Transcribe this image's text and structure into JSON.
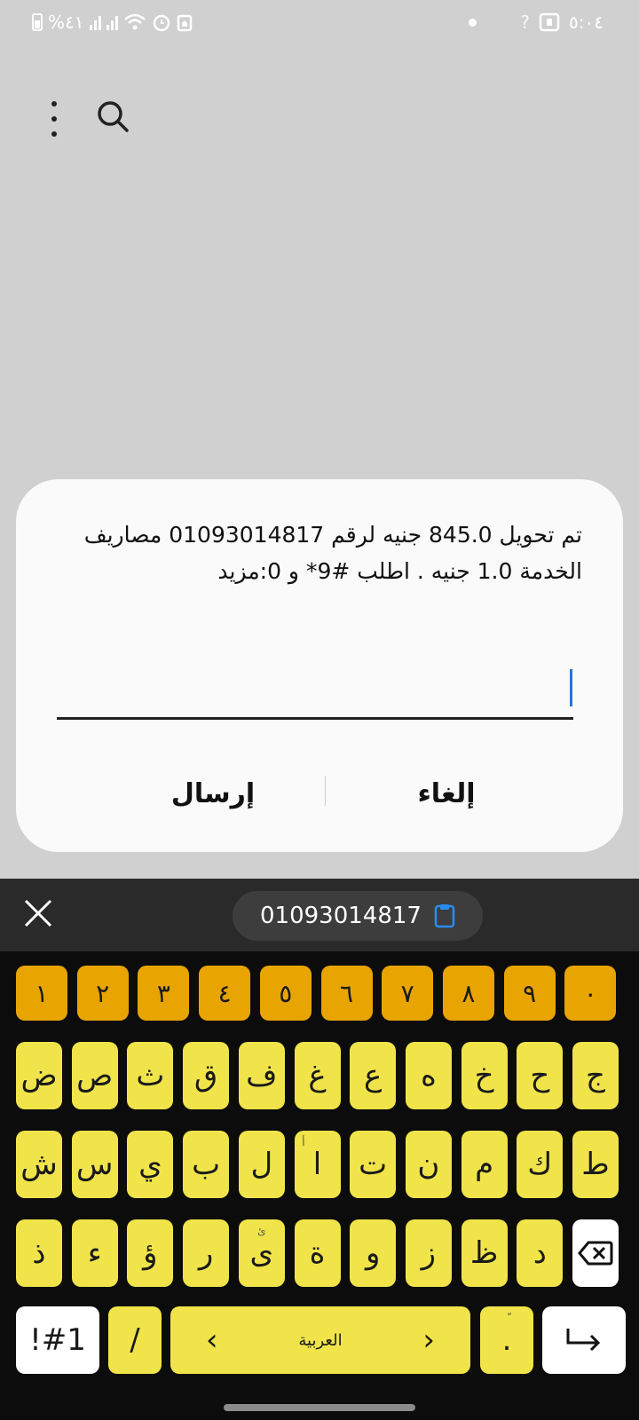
{
  "status_bar": {
    "left_text": "%٤١",
    "right_time": "٥:٠٤",
    "right_signal_label": "?"
  },
  "icons": {
    "more": "more-vert-icon",
    "search": "search-icon",
    "close": "close-icon",
    "clipboard": "clipboard-icon",
    "backspace": "backspace-icon",
    "enter": "enter-icon"
  },
  "dialog": {
    "message": "تم تحويل 845.0 جنيه لرقم 01093014817 مصاريف الخدمة 1.0 جنيه . اطلب #9* و 0:مزيد",
    "send_label": "إرسال",
    "cancel_label": "إلغاء",
    "input_value": ""
  },
  "clipboard": {
    "chip_text": "01093014817"
  },
  "keyboard": {
    "numbers": [
      "١",
      "٢",
      "٣",
      "٤",
      "٥",
      "٦",
      "٧",
      "٨",
      "٩",
      "٠"
    ],
    "row1": [
      "ض",
      "ص",
      "ث",
      "ق",
      "ف",
      "غ",
      "ع",
      "ه",
      "خ",
      "ح",
      "ج"
    ],
    "row2": [
      "ش",
      "س",
      "ي",
      "ب",
      "ل",
      "ا",
      "ت",
      "ن",
      "م",
      "ك",
      "ط"
    ],
    "row3": [
      "ذ",
      "ء",
      "ؤ",
      "ر",
      "ى",
      "ة",
      "و",
      "ز",
      "ظ",
      "د"
    ],
    "hint_alef": "أ",
    "hint_ya": "ئ",
    "symbols_label": "!#1",
    "slash_label": "/",
    "space_label": "العربية",
    "space_left": "‹",
    "space_right": "›",
    "period_label": ".",
    "period_hint": "ّ"
  },
  "colors": {
    "letter_key": "#f0e44a",
    "number_key": "#e8a400",
    "cursor": "#2a73d9"
  }
}
